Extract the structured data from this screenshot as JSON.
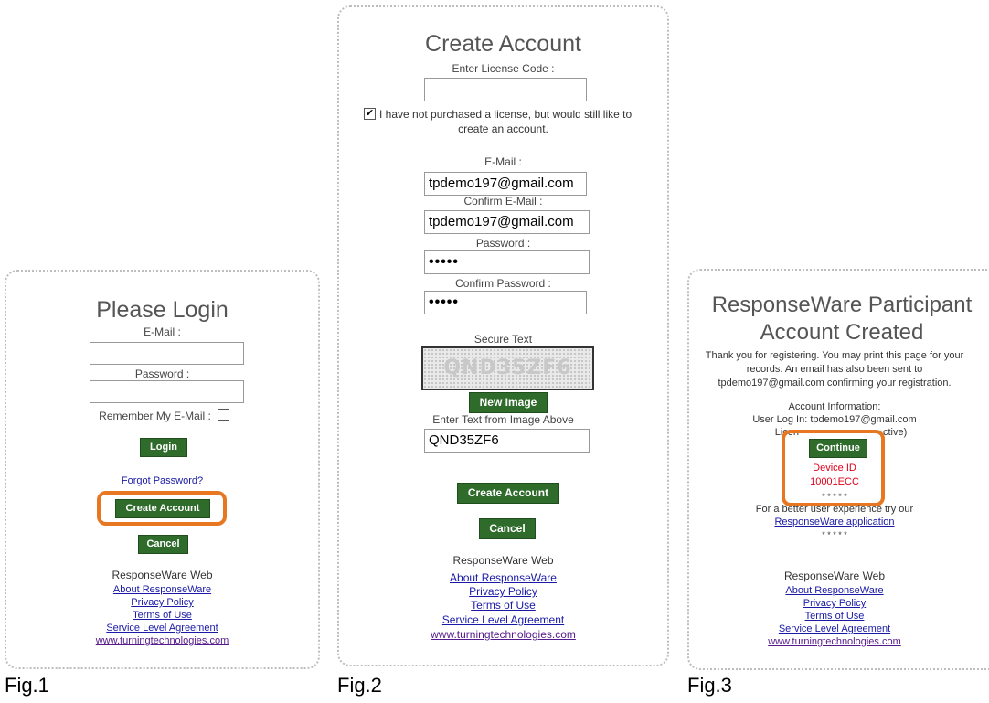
{
  "fig1": {
    "title": "Please Login",
    "email_label": "E-Mail :",
    "password_label": "Password :",
    "remember_label": "Remember My E-Mail :",
    "login_btn": "Login",
    "forgot_link": "Forgot Password?",
    "create_btn": "Create Account",
    "cancel_btn": "Cancel",
    "footer_title": "ResponseWare Web",
    "footer_links": [
      "About ResponseWare",
      "Privacy Policy",
      "Terms of Use",
      "Service Level Agreement",
      "www.turningtechnologies.com"
    ],
    "caption": "Fig.1"
  },
  "fig2": {
    "title": "Create Account",
    "license_label": "Enter License Code :",
    "license_value": "",
    "no_license_line1": "I have not purchased a license, but would still like to",
    "no_license_line2": "create an account.",
    "email_label": "E-Mail :",
    "email_value": "tpdemo197@gmail.com",
    "confirm_email_label": "Confirm E-Mail :",
    "confirm_email_value": "tpdemo197@gmail.com",
    "password_label": "Password :",
    "password_mask": "•••••",
    "confirm_password_label": "Confirm Password :",
    "confirm_password_mask": "•••••",
    "secure_text_label": "Secure Text",
    "captcha_text": "QND35ZF6",
    "new_image_btn": "New Image",
    "enter_text_label": "Enter Text from Image Above",
    "enter_text_value": "QND35ZF6",
    "create_btn": "Create Account",
    "cancel_btn": "Cancel",
    "footer_title": "ResponseWare Web",
    "footer_links": [
      "About ResponseWare",
      "Privacy Policy",
      "Terms of Use",
      "Service Level Agreement",
      "www.turningtechnologies.com"
    ],
    "caption": "Fig.2"
  },
  "fig3": {
    "title_line1": "ResponseWare Participant",
    "title_line2": "Account Created",
    "thanks_line1": "Thank you for registering. You may print this page for your",
    "thanks_line2": "records. An email has also been sent to",
    "thanks_line3": "tpdemo197@gmail.com confirming your registration.",
    "account_info": "Account Information:",
    "user_login": "User Log In: tpdemo197@gmail.com",
    "license_left": "Licen",
    "license_right": "ctive)",
    "continue_btn": "Continue",
    "device_id_label": "Device ID",
    "device_id_value": "10001ECC",
    "stars": "* * * * *",
    "better_exp": "For a better user experience try our",
    "app_link": "ResponseWare application",
    "footer_title": "ResponseWare Web",
    "footer_links": [
      "About ResponseWare",
      "Privacy Policy",
      "Terms of Use",
      "Service Level Agreement",
      "www.turningtechnologies.com"
    ],
    "caption": "Fig.3"
  },
  "colors": {
    "button_green": "#2f6b2b",
    "highlight_orange": "#e87722",
    "link_blue": "#1a1aa6",
    "device_red": "#e0001a"
  }
}
